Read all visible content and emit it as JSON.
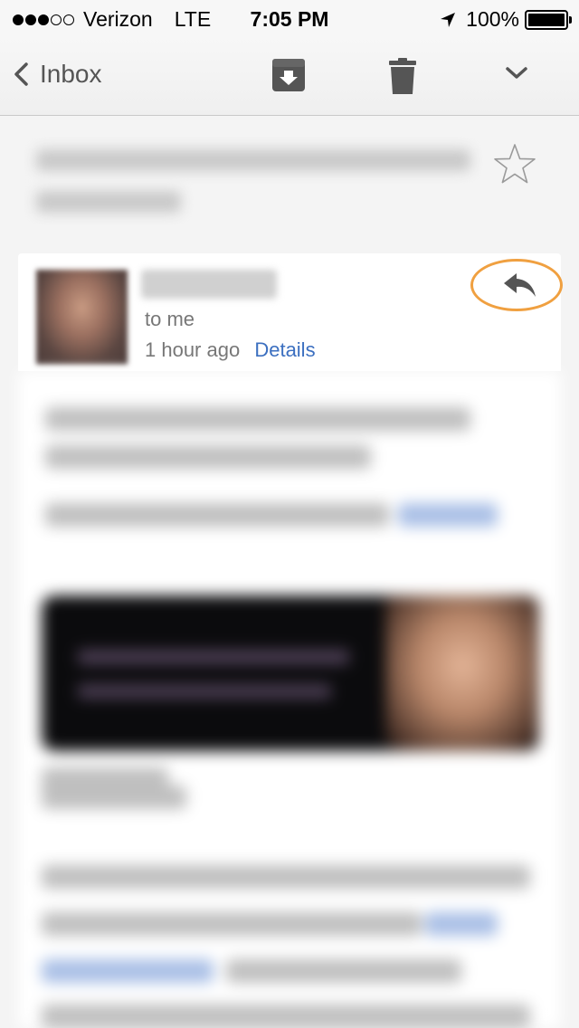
{
  "status_bar": {
    "carrier": "Verizon",
    "network": "LTE",
    "time": "7:05 PM",
    "battery": "100%",
    "signal_bars_filled": 3,
    "signal_bars_total": 5
  },
  "nav": {
    "back_label": "Inbox",
    "icons": [
      "chevron-left-icon",
      "archive-icon",
      "trash-icon",
      "chevron-down-icon"
    ]
  },
  "message": {
    "recipient": "to me",
    "time_ago": "1 hour ago",
    "details_label": "Details",
    "starred": false
  },
  "colors": {
    "link": "#3b6fc0",
    "highlight_ring": "#f0a040",
    "icon": "#555555"
  }
}
